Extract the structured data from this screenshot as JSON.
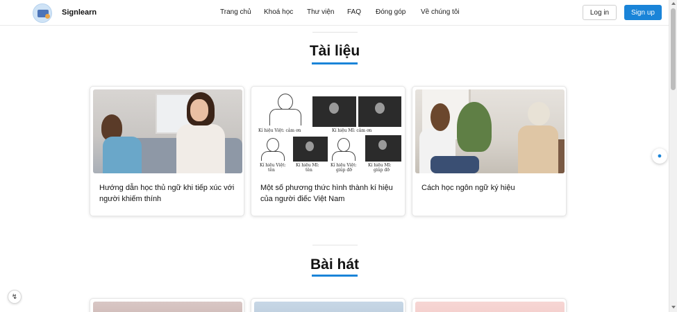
{
  "header": {
    "brand": "Signlearn",
    "nav": [
      "Trang chủ",
      "Khoá học",
      "Thư viện",
      "FAQ",
      "Đóng góp",
      "Về chúng tôi"
    ],
    "login_label": "Log in",
    "signup_label": "Sign up"
  },
  "documents": {
    "title": "Tài liệu",
    "cards": [
      {
        "title": "Hướng dẫn học thủ ngữ khi tiếp xúc với người khiếm thính"
      },
      {
        "title": "Một số phương thức hình thành kí hiệu của người điếc Việt Nam"
      },
      {
        "title": "Cách học ngôn ngữ ký hiệu"
      }
    ]
  },
  "sketch_captions": {
    "c1": "Kí hiệu Việt: cảm ơn",
    "c2": "Kí hiệu Mĩ: cảm ơn",
    "c3": "Kí hiệu Việt:",
    "c3b": "tên",
    "c4": "Kí hiệu Mĩ:",
    "c4b": "tên",
    "c5": "Kí hiệu Việt:",
    "c5b": "giúp đỡ",
    "c6": "Kí hiệu Mĩ:",
    "c6b": "giúp đỡ"
  },
  "songs": {
    "title": "Bài hát"
  },
  "colors": {
    "accent": "#1a84d8"
  },
  "icons": {
    "float": "accessibility-drop-icon",
    "bolt": "bolt-icon"
  }
}
